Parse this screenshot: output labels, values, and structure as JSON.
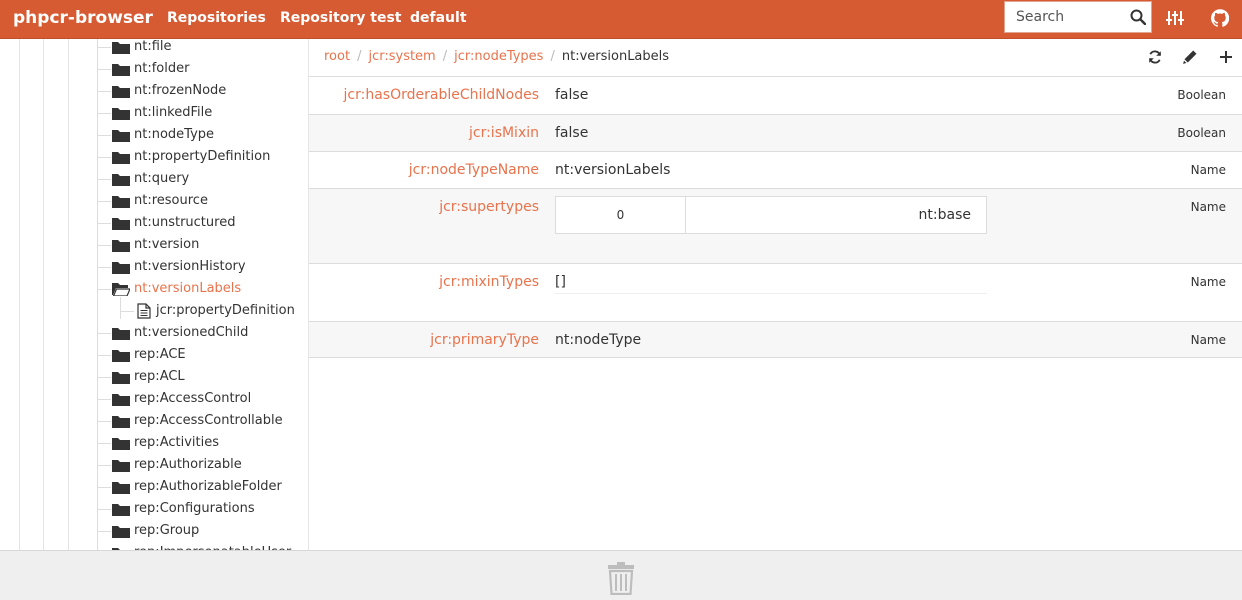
{
  "navbar": {
    "brand": "phpcr-browser",
    "links": [
      "Repositories",
      "Repository test",
      "default"
    ],
    "search_placeholder": "Search",
    "icons": [
      "search-icon",
      "sliders-icon",
      "github-icon"
    ]
  },
  "sidebar": {
    "items": [
      {
        "label": "nt:file"
      },
      {
        "label": "nt:folder"
      },
      {
        "label": "nt:frozenNode"
      },
      {
        "label": "nt:linkedFile"
      },
      {
        "label": "nt:nodeType"
      },
      {
        "label": "nt:propertyDefinition"
      },
      {
        "label": "nt:query"
      },
      {
        "label": "nt:resource"
      },
      {
        "label": "nt:unstructured"
      },
      {
        "label": "nt:version"
      },
      {
        "label": "nt:versionHistory"
      },
      {
        "label": "nt:versionLabels",
        "active": true
      },
      {
        "label": "jcr:propertyDefinition",
        "child": true
      },
      {
        "label": "nt:versionedChild"
      },
      {
        "label": "rep:ACE"
      },
      {
        "label": "rep:ACL"
      },
      {
        "label": "rep:AccessControl"
      },
      {
        "label": "rep:AccessControllable"
      },
      {
        "label": "rep:Activities"
      },
      {
        "label": "rep:Authorizable"
      },
      {
        "label": "rep:AuthorizableFolder"
      },
      {
        "label": "rep:Configurations"
      },
      {
        "label": "rep:Group"
      },
      {
        "label": "rep:ImpersonatableUser"
      }
    ]
  },
  "breadcrumb": {
    "links": [
      "root",
      "jcr:system",
      "jcr:nodeTypes"
    ],
    "current": "nt:versionLabels"
  },
  "toolbar": {
    "icons": [
      "refresh-icon",
      "edit-icon",
      "add-icon"
    ]
  },
  "properties": [
    {
      "name": "jcr:hasOrderableChildNodes",
      "value": "false",
      "type": "Boolean"
    },
    {
      "name": "jcr:isMixin",
      "value": "false",
      "type": "Boolean"
    },
    {
      "name": "jcr:nodeTypeName",
      "value": "nt:versionLabels",
      "type": "Name"
    },
    {
      "name": "jcr:supertypes",
      "multi": [
        {
          "index": "0",
          "value": "nt:base"
        }
      ],
      "type": "Name"
    },
    {
      "name": "jcr:mixinTypes",
      "value": "[]",
      "type": "Name"
    },
    {
      "name": "jcr:primaryType",
      "value": "nt:nodeType",
      "type": "Name"
    }
  ],
  "footer": {
    "icon": "trash-icon"
  },
  "colors": {
    "brand": "#d65a32",
    "accent": "#e8734c"
  }
}
